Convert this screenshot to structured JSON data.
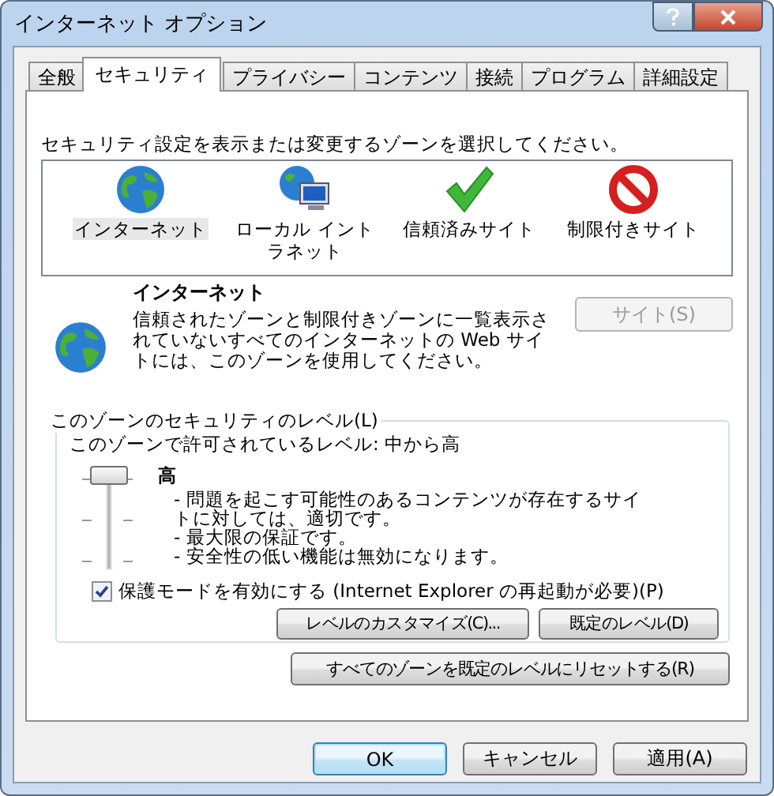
{
  "window": {
    "title": "インターネット オプション"
  },
  "tabs": [
    {
      "label": "全般",
      "selected": false
    },
    {
      "label": "セキュリティ",
      "selected": true
    },
    {
      "label": "プライバシー",
      "selected": false
    },
    {
      "label": "コンテンツ",
      "selected": false
    },
    {
      "label": "接続",
      "selected": false
    },
    {
      "label": "プログラム",
      "selected": false
    },
    {
      "label": "詳細設定",
      "selected": false
    }
  ],
  "instruction": "セキュリティ設定を表示または変更するゾーンを選択してください。",
  "zones": [
    {
      "kind": "globe",
      "label": "インターネット",
      "selected": true
    },
    {
      "kind": "intranet",
      "label": "ローカル イントラネット",
      "selected": false
    },
    {
      "kind": "trusted",
      "label": "信頼済みサイト",
      "selected": false
    },
    {
      "kind": "restricted",
      "label": "制限付きサイト",
      "selected": false
    }
  ],
  "zone_info": {
    "kind": "globe",
    "title": "インターネット",
    "description": "信頼されたゾーンと制限付きゾーンに一覧表示されていないすべてのインターネットの Web サイトには、このゾーンを使用してください。",
    "sites_button": {
      "label": "サイト(S)",
      "disabled": true
    }
  },
  "security_level": {
    "group_title": "このゾーンのセキュリティのレベル(L)",
    "allowed": "このゾーンで許可されているレベル: 中から高",
    "level": 1,
    "level_name": "高",
    "details": [
      "- 問題を起こす可能性のあるコンテンツが存在するサイトに対しては、適切です。",
      "- 最大限の保証です。",
      "- 安全性の低い機能は無効になります。"
    ],
    "protected_mode": {
      "label": "保護モードを有効にする (Internet Explorer の再起動が必要)(P)",
      "checked": true
    },
    "buttons": [
      "レベルのカスタマイズ(C)...",
      "既定のレベル(D)"
    ]
  },
  "reset_button": "すべてのゾーンを既定のレベルにリセットする(R)",
  "dialog_buttons": [
    {
      "label": "OK",
      "default": true
    },
    {
      "label": "キャンセル",
      "default": false
    },
    {
      "label": "適用(A)",
      "default": false
    }
  ]
}
